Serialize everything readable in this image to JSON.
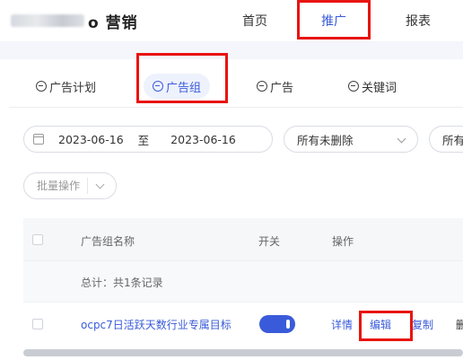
{
  "header": {
    "logo_suffix": "o 营销",
    "nav": {
      "home": "首页",
      "promotion": "推广",
      "report": "报表"
    }
  },
  "tabs": {
    "plan": "广告计划",
    "group": "广告组",
    "ad": "广告",
    "keyword": "关键词"
  },
  "filters": {
    "date_start": "2023-06-16",
    "date_separator": "至",
    "date_end": "2023-06-16",
    "status_value": "所有未删除",
    "next_value": "所有"
  },
  "batch": {
    "label": "批量操作"
  },
  "table": {
    "columns": {
      "name": "广告组名称",
      "switch": "开关",
      "action": "操作"
    },
    "summary": "总计：共1条记录",
    "rows": [
      {
        "name": "ocpc7日活跃天数行业专属目标",
        "switch_on": true,
        "actions": {
          "detail": "详情",
          "edit": "编辑",
          "copy": "复制",
          "more": "删"
        }
      }
    ]
  },
  "colors": {
    "accent": "#3a5bd9",
    "highlight": "#e8140f"
  }
}
